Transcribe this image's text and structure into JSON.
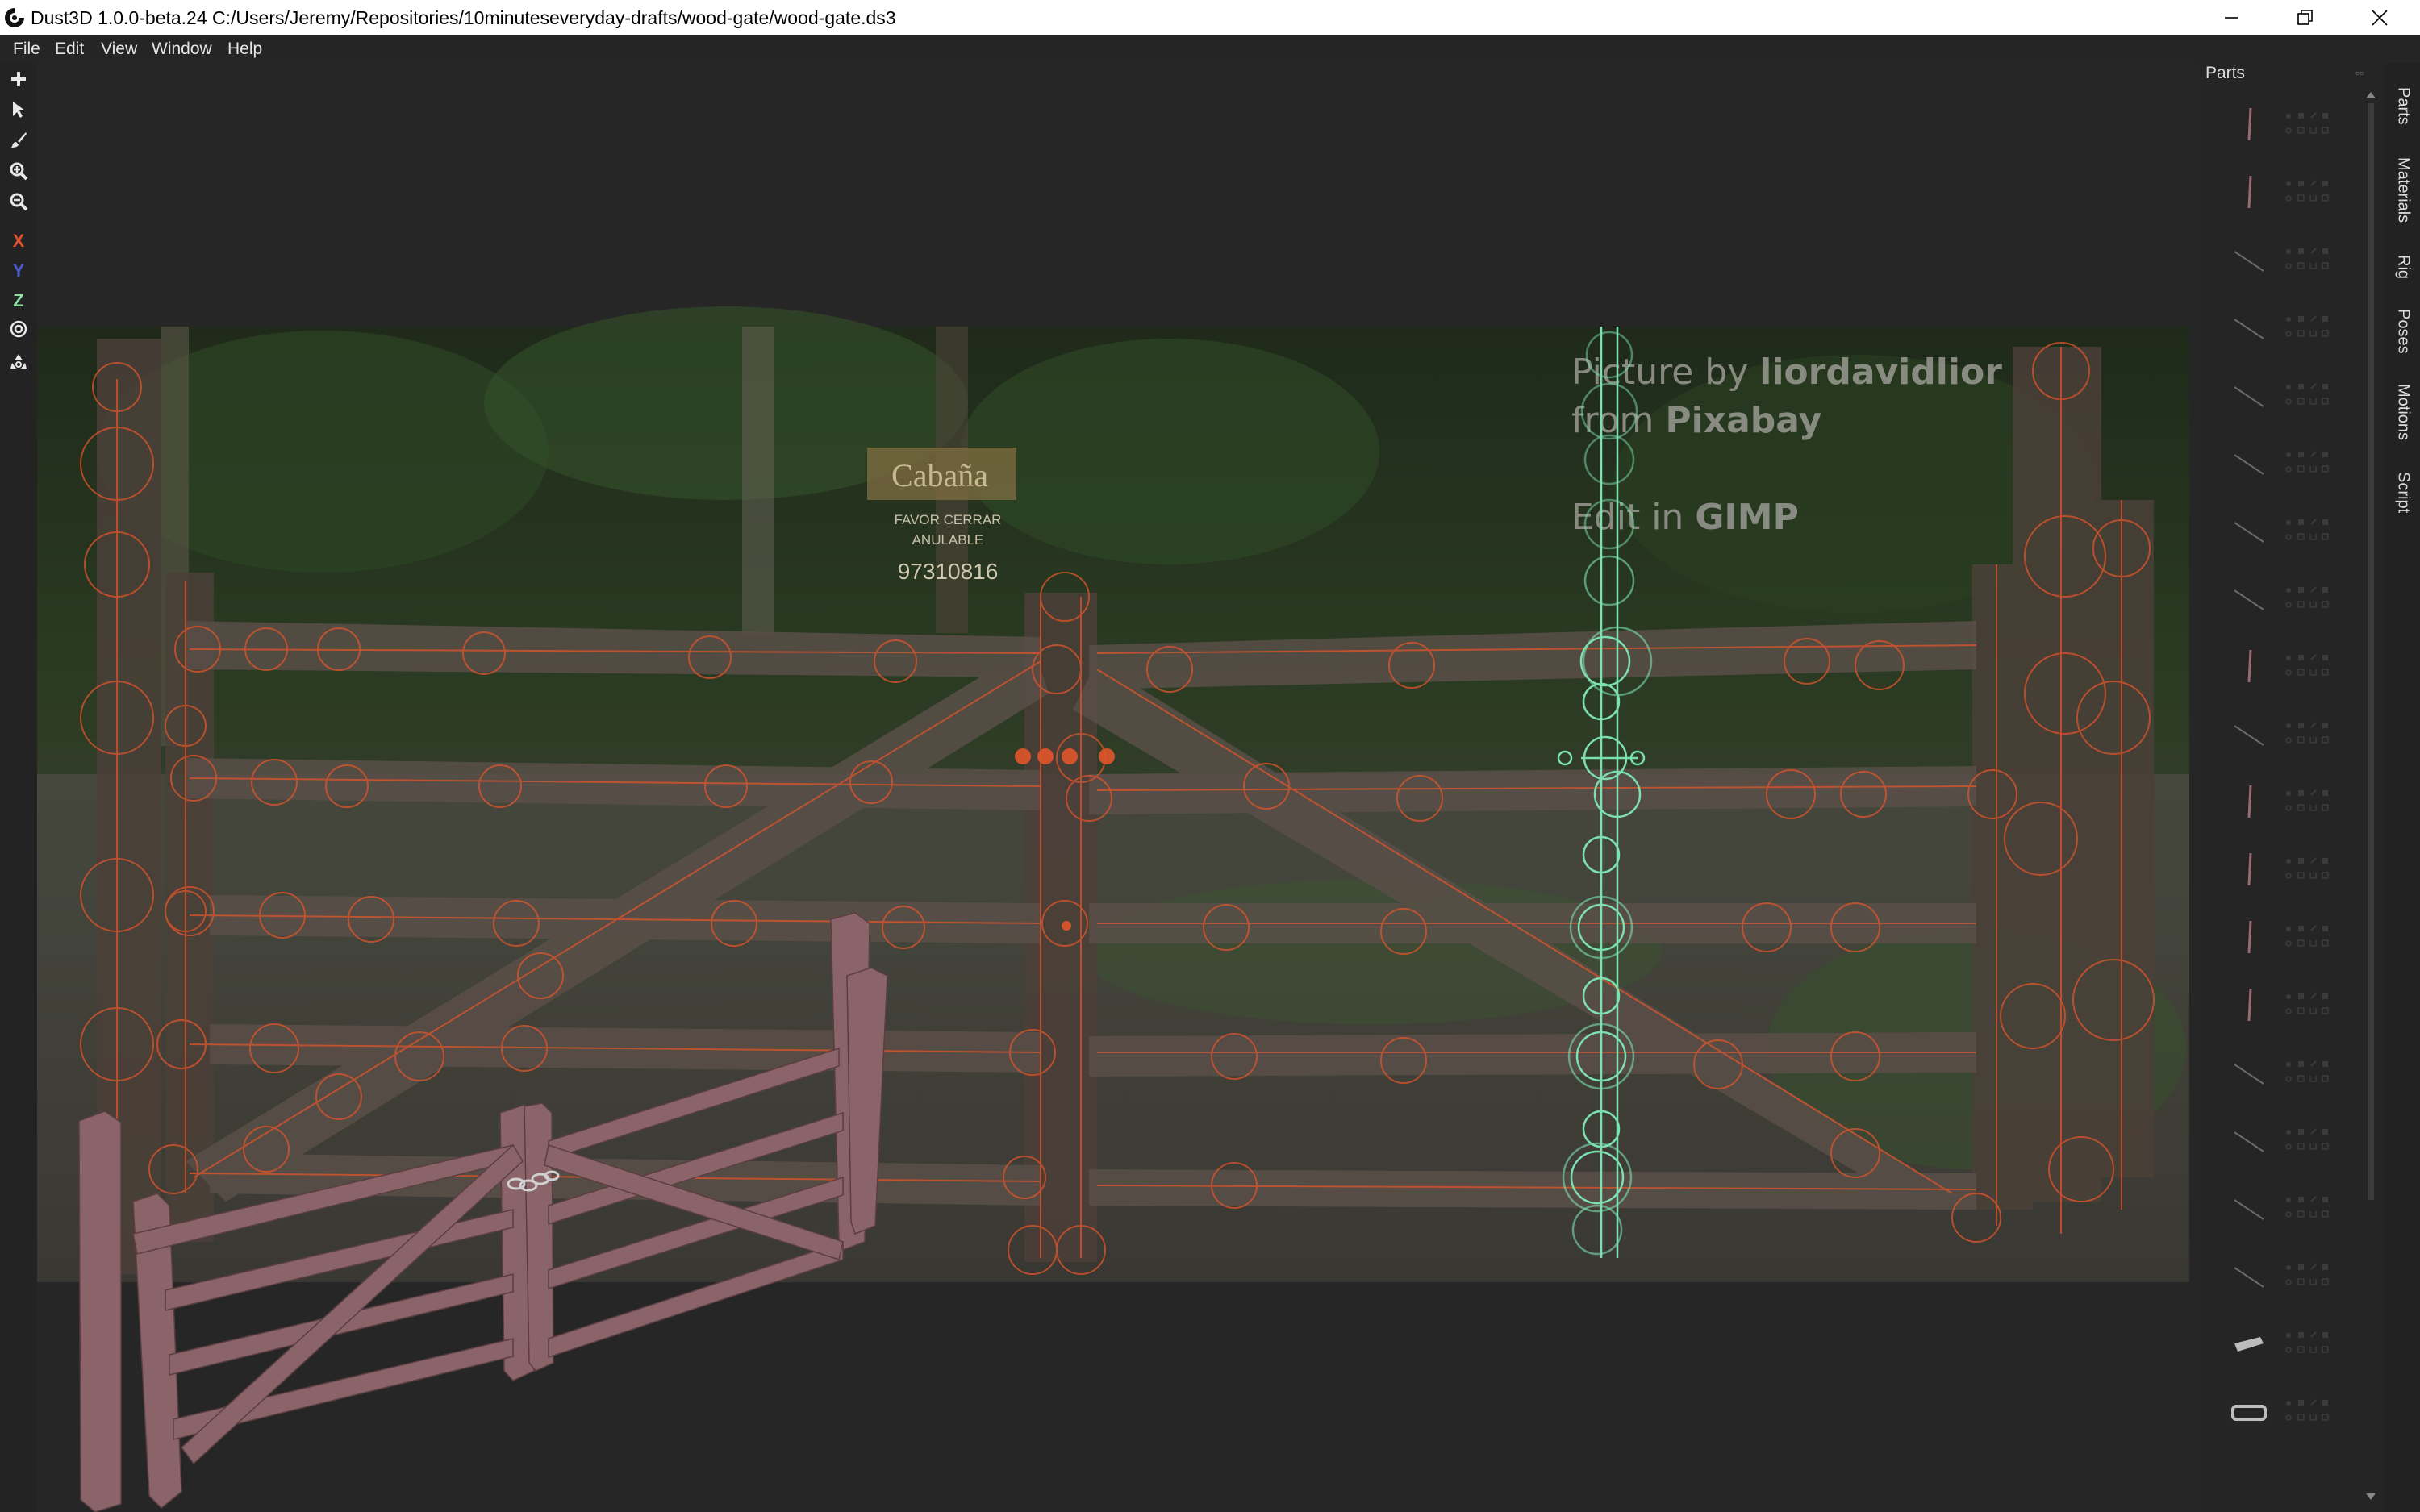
{
  "window": {
    "title": "Dust3D 1.0.0-beta.24 C:/Users/Jeremy/Repositories/10minuteseveryday-drafts/wood-gate/wood-gate.ds3",
    "controls": [
      "minimize-icon",
      "restore-icon",
      "close-icon"
    ]
  },
  "menu": [
    "File",
    "Edit",
    "View",
    "Window",
    "Help"
  ],
  "toolbar": {
    "tools": [
      "add-icon",
      "select-icon",
      "paint-brush-icon",
      "zoom-in-icon",
      "zoom-out-icon"
    ],
    "axis_x": "X",
    "axis_y": "Y",
    "axis_z": "Z",
    "extra": [
      "radial-mirror-icon",
      "recycle-icon"
    ],
    "colors": {
      "x": "#e0502a",
      "y": "#4a5bd0",
      "z": "#8fe0a0"
    }
  },
  "canvas": {
    "watermark": {
      "line1_prefix": "Picture by ",
      "line1_bold": "liordavidlior",
      "line2_prefix": "from ",
      "line2_bold": "Pixabay",
      "line3_prefix": "Edit in ",
      "line3_bold": "GIMP"
    },
    "sign": {
      "title": "Cabaña",
      "line1": "FAVOR CERRAR",
      "line2": "ANULABLE",
      "phone": "97310816"
    },
    "nodes_color": "#e0552b",
    "selected_nodes_color": "#7de0b0",
    "model_color": "#8a6468"
  },
  "parts_panel": {
    "title": "Parts",
    "part_count": 20
  },
  "side_tabs": [
    "Parts",
    "Materials",
    "Rig",
    "Poses",
    "Motions",
    "Script"
  ]
}
